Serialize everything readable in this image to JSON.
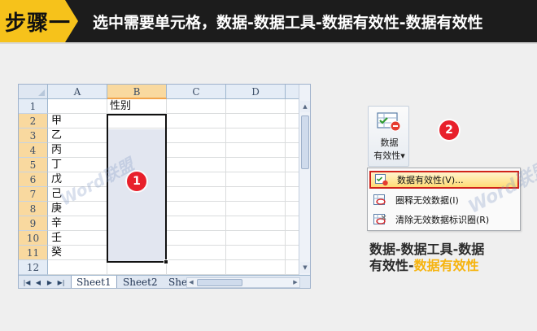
{
  "header": {
    "step_label": "步骤一",
    "instruction": "选中需要单元格，数据-数据工具-数据有效性-数据有效性"
  },
  "spreadsheet": {
    "columns": [
      "A",
      "B",
      "C",
      "D"
    ],
    "selected_column": "B",
    "rows": [
      "1",
      "2",
      "3",
      "4",
      "5",
      "6",
      "7",
      "8",
      "9",
      "10",
      "11",
      "12"
    ],
    "cell_b1": "性别",
    "column_a_values": [
      "甲",
      "乙",
      "丙",
      "丁",
      "戊",
      "己",
      "庚",
      "辛",
      "壬",
      "癸"
    ],
    "sheet_tabs": [
      "Sheet1",
      "Sheet2",
      "She"
    ],
    "active_tab": "Sheet1"
  },
  "badges": {
    "one": "1",
    "two": "2"
  },
  "ribbon": {
    "button_line1": "数据",
    "button_line2": "有效性",
    "dropdown_arrow": "▾",
    "icon": "data-validation-icon"
  },
  "menu": {
    "items": [
      {
        "label": "数据有效性(V)...",
        "icon": "data-validation-icon",
        "highlighted": true
      },
      {
        "label": "圈释无效数据(I)",
        "icon": "circle-invalid-icon",
        "highlighted": false
      },
      {
        "label": "清除无效数据标识圈(R)",
        "icon": "clear-circles-icon",
        "highlighted": false
      }
    ]
  },
  "caption": {
    "line1": "数据-数据工具-数据",
    "line2_dark": "有效性-",
    "line2_highlight": "数据有效性"
  },
  "watermark": {
    "text": "Word联盟"
  },
  "colors": {
    "accent_yellow": "#f6c21b",
    "badge_red": "#e8202b",
    "banner_bg": "#1c1c1c",
    "highlight_border": "#d0231a"
  }
}
